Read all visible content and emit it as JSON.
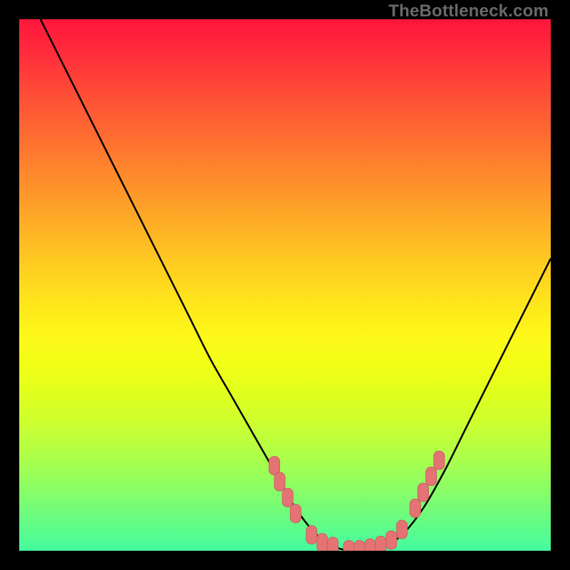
{
  "watermark": "TheBottleneck.com",
  "colors": {
    "curve_stroke": "#000000",
    "marker_fill": "#e57373",
    "marker_stroke": "#c76262",
    "frame": "#000000"
  },
  "chart_data": {
    "type": "line",
    "title": "",
    "xlabel": "",
    "ylabel": "",
    "xlim": [
      0,
      100
    ],
    "ylim": [
      0,
      100
    ],
    "grid": false,
    "series": [
      {
        "name": "bottleneck-curve",
        "x": [
          4,
          8,
          12,
          16,
          20,
          24,
          28,
          32,
          36,
          40,
          44,
          48,
          52,
          56,
          60,
          64,
          68,
          72,
          76,
          80,
          84,
          88,
          92,
          96,
          100
        ],
        "values": [
          100,
          92,
          84,
          76,
          68,
          60,
          52,
          44,
          36,
          29,
          22,
          15,
          8,
          3,
          0.5,
          0,
          0.5,
          3,
          8,
          15,
          23,
          31,
          39,
          47,
          55
        ]
      }
    ],
    "markers": {
      "name": "highlighted-points",
      "points": [
        {
          "x": 48,
          "y": 16
        },
        {
          "x": 49,
          "y": 13
        },
        {
          "x": 50.5,
          "y": 10
        },
        {
          "x": 52,
          "y": 7
        },
        {
          "x": 55,
          "y": 3
        },
        {
          "x": 57,
          "y": 1.5
        },
        {
          "x": 59,
          "y": 0.8
        },
        {
          "x": 62,
          "y": 0.2
        },
        {
          "x": 64,
          "y": 0.2
        },
        {
          "x": 66,
          "y": 0.5
        },
        {
          "x": 68,
          "y": 1
        },
        {
          "x": 70,
          "y": 2
        },
        {
          "x": 72,
          "y": 4
        },
        {
          "x": 74.5,
          "y": 8
        },
        {
          "x": 76,
          "y": 11
        },
        {
          "x": 77.5,
          "y": 14
        },
        {
          "x": 79,
          "y": 17
        }
      ]
    }
  }
}
